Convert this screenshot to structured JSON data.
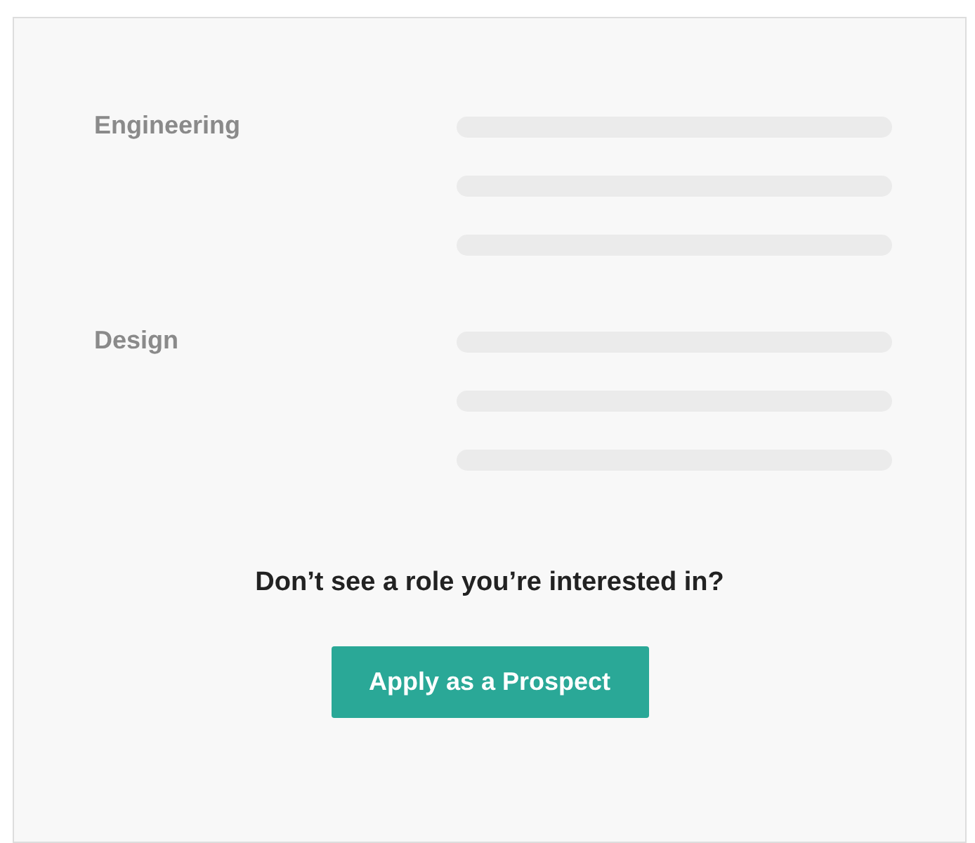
{
  "sections": [
    {
      "title": "Engineering"
    },
    {
      "title": "Design"
    }
  ],
  "prompt": "Don’t see a role you’re interested in?",
  "button": "Apply as a Prospect"
}
